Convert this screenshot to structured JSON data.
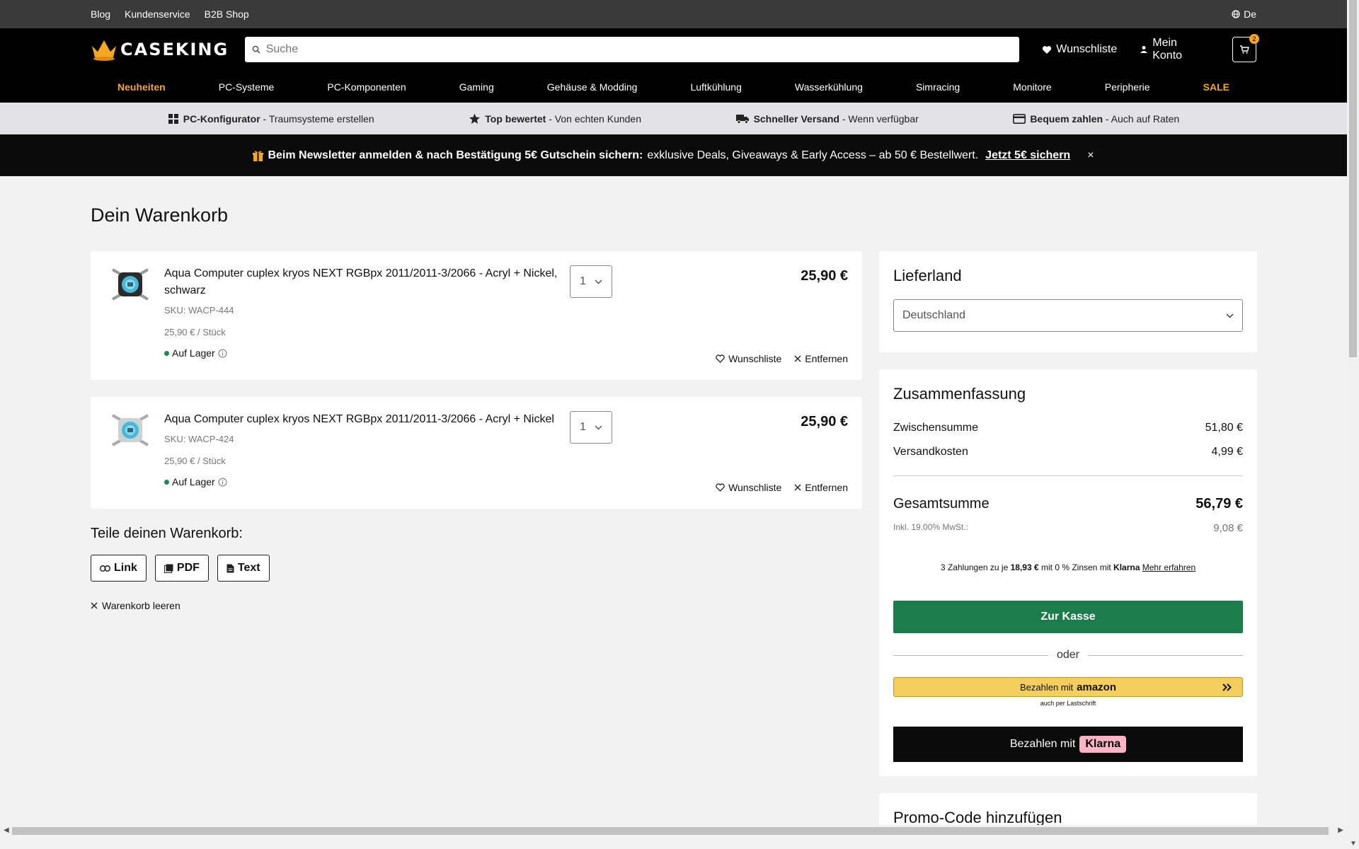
{
  "topbar": {
    "links": [
      "Blog",
      "Kundenservice",
      "B2B Shop"
    ],
    "language": "De"
  },
  "header": {
    "logo_text": "CASEKING",
    "search_placeholder": "Suche",
    "wishlist": "Wunschliste",
    "account": "Mein Konto",
    "cart_count": "2"
  },
  "nav": [
    "Neuheiten",
    "PC-Systeme",
    "PC-Komponenten",
    "Gaming",
    "Gehäuse & Modding",
    "Luftkühlung",
    "Wasserkühlung",
    "Simracing",
    "Monitore",
    "Peripherie",
    "SALE"
  ],
  "usp": [
    {
      "bold": "PC-Konfigurator",
      "text": " - Traumsysteme erstellen"
    },
    {
      "bold": "Top bewertet",
      "text": " - Von echten Kunden"
    },
    {
      "bold": "Schneller Versand",
      "text": " - Wenn verfügbar"
    },
    {
      "bold": "Bequem zahlen",
      "text": " - Auch auf Raten"
    }
  ],
  "newsletter": {
    "bold": "Beim Newsletter anmelden & nach Bestätigung 5€ Gutschein sichern:",
    "text": "exklusive Deals, Giveaways & Early Access – ab 50 € Bestellwert.",
    "cta": "Jetzt 5€ sichern",
    "close": "×"
  },
  "page_title": "Dein Warenkorb",
  "items": [
    {
      "title": "Aqua Computer cuplex kryos NEXT RGBpx 2011/2011-3/2066 - Acryl + Nickel, schwarz",
      "sku": "SKU: WACP-444",
      "unit_price": "25,90 € / Stück",
      "stock": "Auf Lager",
      "qty": "1",
      "price": "25,90 €",
      "wishlist": "Wunschliste",
      "remove": "Entfernen"
    },
    {
      "title": "Aqua Computer cuplex kryos NEXT RGBpx 2011/2011-3/2066 - Acryl + Nickel",
      "sku": "SKU: WACP-424",
      "unit_price": "25,90 € / Stück",
      "stock": "Auf Lager",
      "qty": "1",
      "price": "25,90 €",
      "wishlist": "Wunschliste",
      "remove": "Entfernen"
    }
  ],
  "share": {
    "title": "Teile deinen Warenkorb:",
    "link": "Link",
    "pdf": "PDF",
    "text": "Text"
  },
  "clear_cart": "Warenkorb leeren",
  "country": {
    "title": "Lieferland",
    "selected": "Deutschland"
  },
  "summary": {
    "title": "Zusammenfassung",
    "subtotal_label": "Zwischensumme",
    "subtotal": "51,80 €",
    "shipping_label": "Versandkosten",
    "shipping": "4,99 €",
    "total_label": "Gesamtsumme",
    "total": "56,79 €",
    "tax_label": "Inkl. 19.00% MwSt.:",
    "tax": "9,08 €",
    "klarna_pre": "3 Zahlungen zu je",
    "klarna_amount": "18,93 €",
    "klarna_mid": "mit 0 % Zinsen mit",
    "klarna_brand": "Klarna",
    "klarna_more": "Mehr erfahren",
    "checkout": "Zur Kasse",
    "or": "oder",
    "amazon_pre": "Bezahlen mit",
    "amazon_brand": "amazon",
    "amazon_sub": "auch per Lastschrift",
    "klarna_btn_pre": "Bezahlen mit",
    "klarna_btn_brand": "Klarna"
  },
  "promo_title": "Promo-Code hinzufügen",
  "colors": {
    "accent": "#f5a623",
    "checkout": "#1c7c4b",
    "in_stock": "#1e8a4f",
    "klarna_pink": "#ffb3c7",
    "amazon": "#f3ce5c"
  }
}
